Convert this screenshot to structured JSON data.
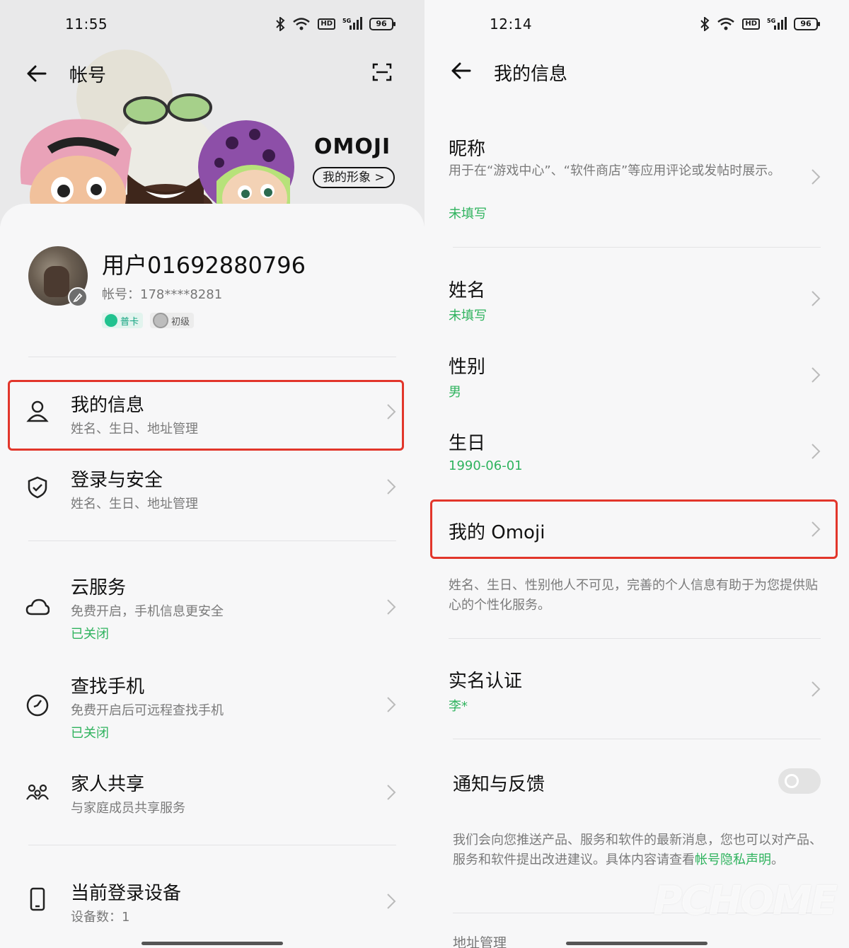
{
  "left": {
    "status": {
      "time": "11:55",
      "battery": "96"
    },
    "header": {
      "title": "帐号"
    },
    "omoji": {
      "logo": "OMOJI",
      "button": "我的形象 >"
    },
    "profile": {
      "username": "用户01692880796",
      "account": "帐号：178****8281",
      "badge_card": "普卡",
      "badge_level": "初级"
    },
    "items": [
      {
        "title": "我的信息",
        "sub": "姓名、生日、地址管理",
        "icon": "person-icon"
      },
      {
        "title": "登录与安全",
        "sub": "姓名、生日、地址管理",
        "icon": "shield-icon"
      },
      {
        "title": "云服务",
        "sub": "免费开启，手机信息更安全",
        "status": "已关闭",
        "icon": "cloud-icon"
      },
      {
        "title": "查找手机",
        "sub": "免费开启后可远程查找手机",
        "status": "已关闭",
        "icon": "locate-icon"
      },
      {
        "title": "家人共享",
        "sub": "与家庭成员共享服务",
        "icon": "family-icon"
      },
      {
        "title": "当前登录设备",
        "sub": "设备数：1",
        "icon": "phone-icon"
      }
    ]
  },
  "right": {
    "status": {
      "time": "12:14",
      "battery": "96"
    },
    "header": {
      "title": "我的信息"
    },
    "nickname": {
      "title": "昵称",
      "desc": "用于在“游戏中心”、“软件商店”等应用评论或发帖时展示。",
      "value": "未填写"
    },
    "name": {
      "title": "姓名",
      "value": "未填写"
    },
    "gender": {
      "title": "性别",
      "value": "男"
    },
    "birthday": {
      "title": "生日",
      "value": "1990-06-01"
    },
    "omoji": {
      "title": "我的 Omoji"
    },
    "privacy_note": "姓名、生日、性别他人不可见，完善的个人信息有助于为您提供贴心的个性化服务。",
    "realname": {
      "title": "实名认证",
      "value": "李*"
    },
    "notify": {
      "title": "通知与反馈",
      "enabled": false
    },
    "notify_note": "我们会向您推送产品、服务和软件的最新消息，您也可以对产品、服务和软件提出改进建议。具体内容请查看",
    "notify_link": "帐号隐私声明",
    "notify_end": "。",
    "address": {
      "title": "地址管理"
    },
    "watermark": "PCHOME"
  },
  "colors": {
    "accent_green": "#2fb35e",
    "highlight_red": "#e2362b"
  }
}
